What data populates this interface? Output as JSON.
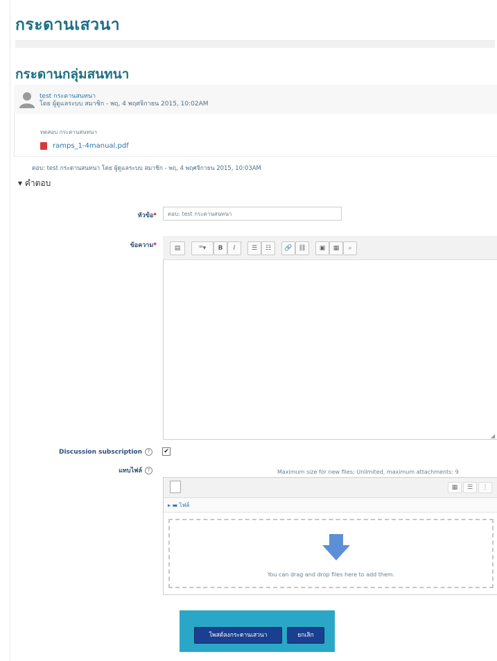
{
  "page": {
    "title": "กระดานเสวนา",
    "forum_name": "กระดานกลุ่มสนทนา"
  },
  "post": {
    "subject": "test กระดานสนทนา",
    "byline": "โดย ผู้ดูแลระบบ สมาชิก - พฤ, 4 พฤศจิกายน 2015, 10:02AM",
    "body": "ทดสอบ กระดานสนทนา",
    "attachment": "ramps_1-4manual.pdf"
  },
  "reply_info": "ตอบ: test กระดานสนทนา โดย ผู้ดูแลระบบ สมาชิก - พฤ, 4 พฤศจิกายน 2015, 10:03AM",
  "form": {
    "section_title": "คำตอบ",
    "subject_label": "หัวข้อ",
    "subject_value": "ตอบ: test กระดานสนทนา",
    "message_label": "ข้อความ",
    "required_mark": "*",
    "subscription_label": "Discussion subscription",
    "subscription_checked": true,
    "attachment_label": "แทบไฟล์",
    "max_size_text": "Maximum size for new files: Unlimited, maximum attachments: 9",
    "folder_label": "ไฟล์",
    "drop_text": "You can drag and drop files here to add them.",
    "help_symbol": "?"
  },
  "editor_toolbar": {
    "buttons": [
      "▤",
      "ꟹ▾",
      "B",
      "I",
      "☰",
      "☷",
      "🔗",
      "⛓",
      "▣",
      "▦",
      "⌕"
    ]
  },
  "actions": {
    "submit_label": "โพสต์ลงกระดานเสวนา",
    "cancel_label": "ยกเลิก"
  },
  "colors": {
    "heading": "#1f6f85",
    "link": "#2a77a8",
    "button": "#1b3f8f",
    "button_panel": "#2aa7c7"
  }
}
